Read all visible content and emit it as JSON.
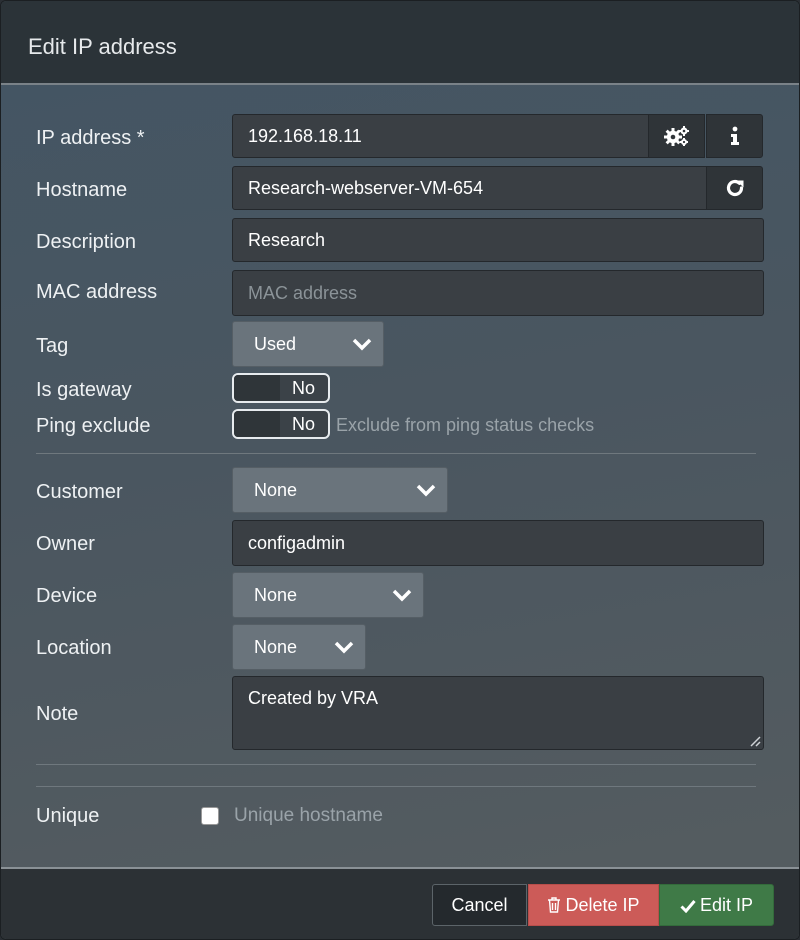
{
  "dialog": {
    "title": "Edit IP address"
  },
  "fields": {
    "ip_address": {
      "label": "IP address *",
      "value": "192.168.18.11"
    },
    "hostname": {
      "label": "Hostname",
      "value": "Research-webserver-VM-654"
    },
    "description": {
      "label": "Description",
      "value": "Research"
    },
    "mac_address": {
      "label": "MAC address",
      "placeholder": "MAC address"
    },
    "tag": {
      "label": "Tag",
      "value": "Used"
    },
    "is_gateway": {
      "label": "Is gateway",
      "value": "No"
    },
    "ping_exclude": {
      "label": "Ping exclude",
      "value": "No",
      "hint": "Exclude from ping status checks"
    },
    "customer": {
      "label": "Customer",
      "value": "None"
    },
    "owner": {
      "label": "Owner",
      "value": "configadmin"
    },
    "device": {
      "label": "Device",
      "value": "None"
    },
    "location": {
      "label": "Location",
      "value": "None"
    },
    "note": {
      "label": "Note",
      "value": "Created by VRA"
    },
    "unique": {
      "label": "Unique",
      "checkbox_label": "Unique hostname",
      "checked": false
    }
  },
  "icons": {
    "ip_settings": "gears-icon",
    "ip_info": "info-icon",
    "hostname_refresh": "refresh-icon",
    "delete": "trash-icon",
    "edit": "check-icon"
  },
  "buttons": {
    "cancel": "Cancel",
    "delete": "Delete IP",
    "edit": "Edit IP"
  },
  "colors": {
    "delete": "#cc5b58",
    "edit": "#3f7a47",
    "cancel": "#24292d"
  }
}
